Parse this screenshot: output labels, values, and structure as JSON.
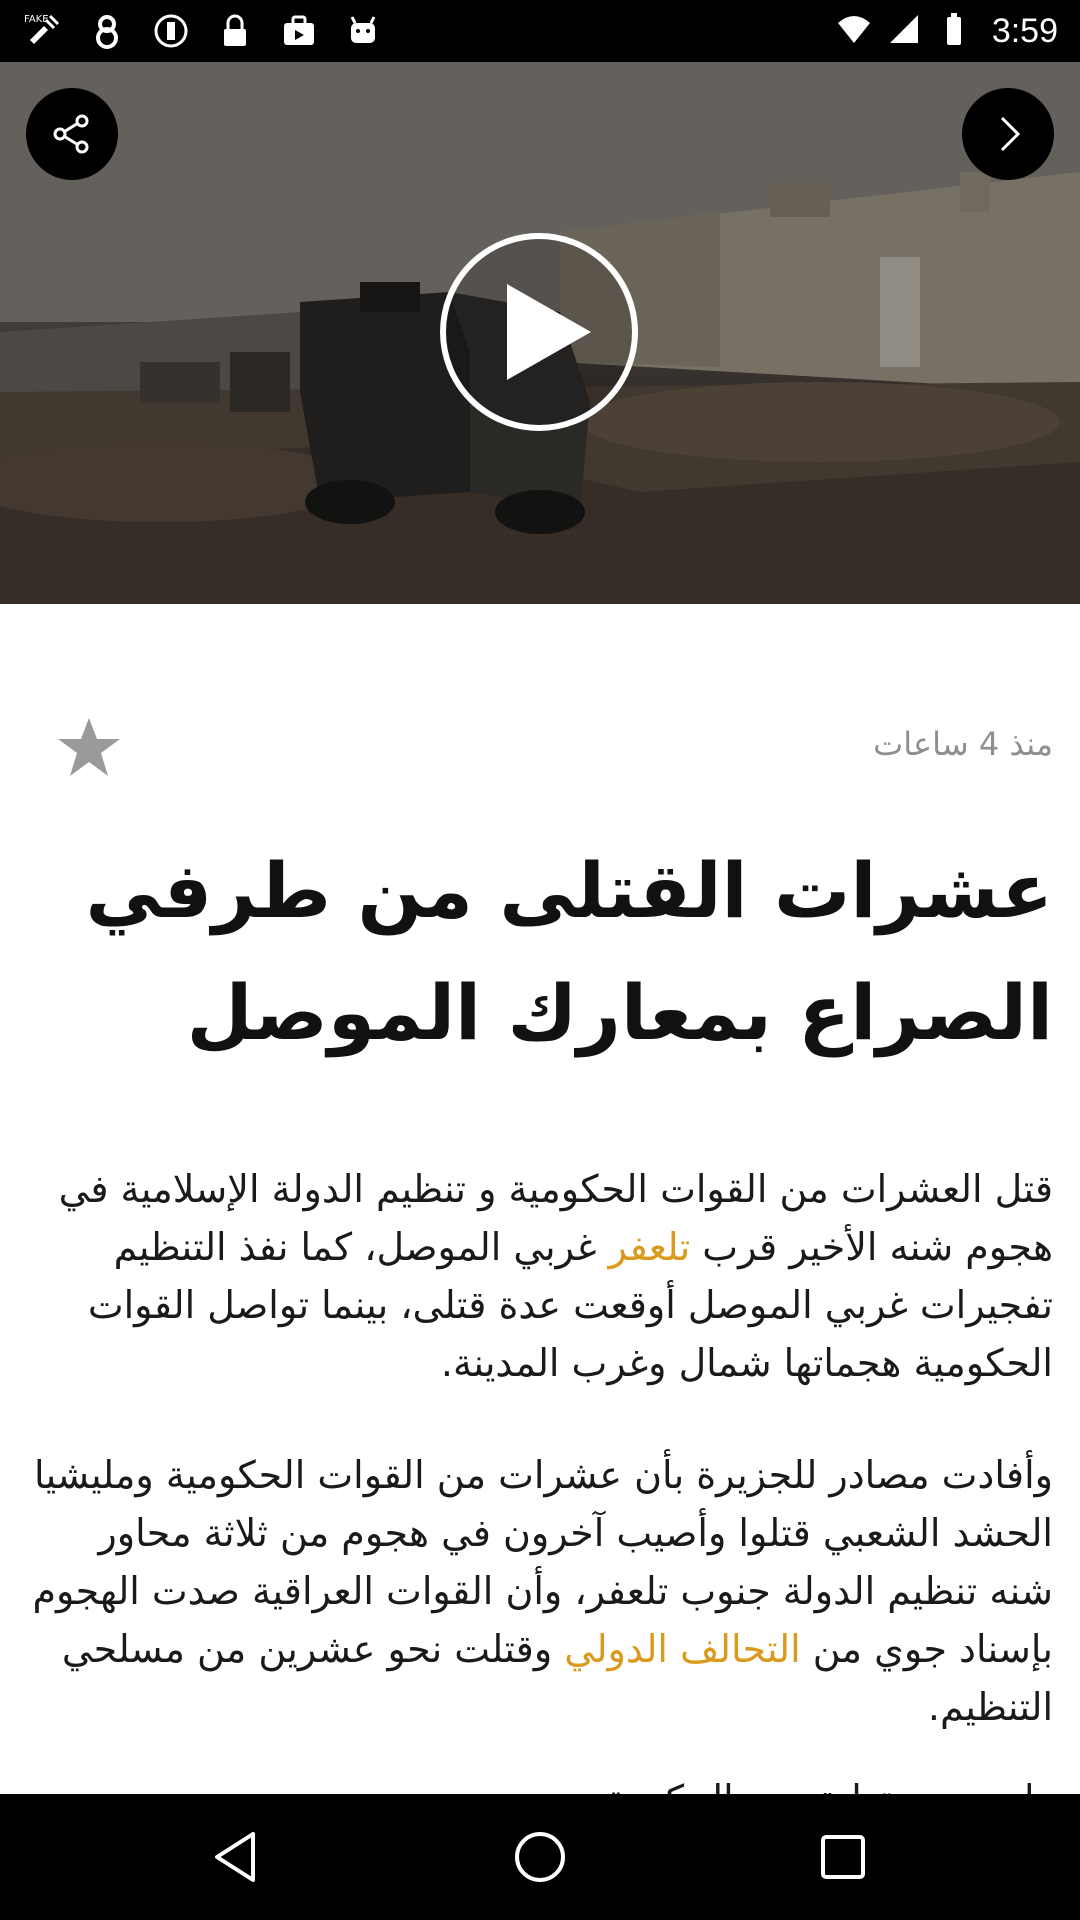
{
  "status_bar": {
    "time": "3:59",
    "left_icons": [
      "fake-gps-icon",
      "notification-icon",
      "info-icon",
      "lock-icon",
      "briefcase-icon",
      "android-icon"
    ],
    "right_icons": [
      "wifi-icon",
      "signal-icon",
      "battery-icon"
    ]
  },
  "video": {
    "share_icon": "share-icon",
    "next_icon": "chevron-right-icon",
    "play_icon": "play-icon"
  },
  "article": {
    "time_ago": "منذ 4 ساعات",
    "favorite_icon": "star-icon",
    "headline": "عشرات القتلى من طرفي الصراع بمعارك الموصل",
    "paragraph_1": {
      "part_1": "قتل العشرات من القوات الحكومية و تنظيم الدولة الإسلامية في هجوم شنه الأخير قرب ",
      "link": "تلعفر",
      "part_2": " غربي الموصل، كما نفذ التنظيم تفجيرات غربي الموصل أوقعت عدة قتلى، بينما تواصل القوات الحكومية هجماتها شمال وغرب المدينة."
    },
    "paragraph_2": {
      "part_1": "وأفادت مصادر للجزيرة بأن عشرات من القوات الحكومية ومليشيا الحشد الشعبي قتلوا وأصيب آخرون في هجوم من ثلاثة محاور شنه تنظيم الدولة جنوب تلعفر، وأن القوات العراقية صدت الهجوم بإسناد جوي من ",
      "link": "التحالف الدولي",
      "part_2": " وقتلت نحو عشرين من مسلحي التنظيم."
    },
    "paragraph_3_partial": "ولم يصدر تعليق من الحكومة"
  },
  "colors": {
    "link": "#d99a1e",
    "meta_text": "#8f8f8f",
    "headline": "#111111"
  },
  "nav_bar": {
    "icons": [
      "back-icon",
      "home-icon",
      "recents-icon"
    ]
  }
}
